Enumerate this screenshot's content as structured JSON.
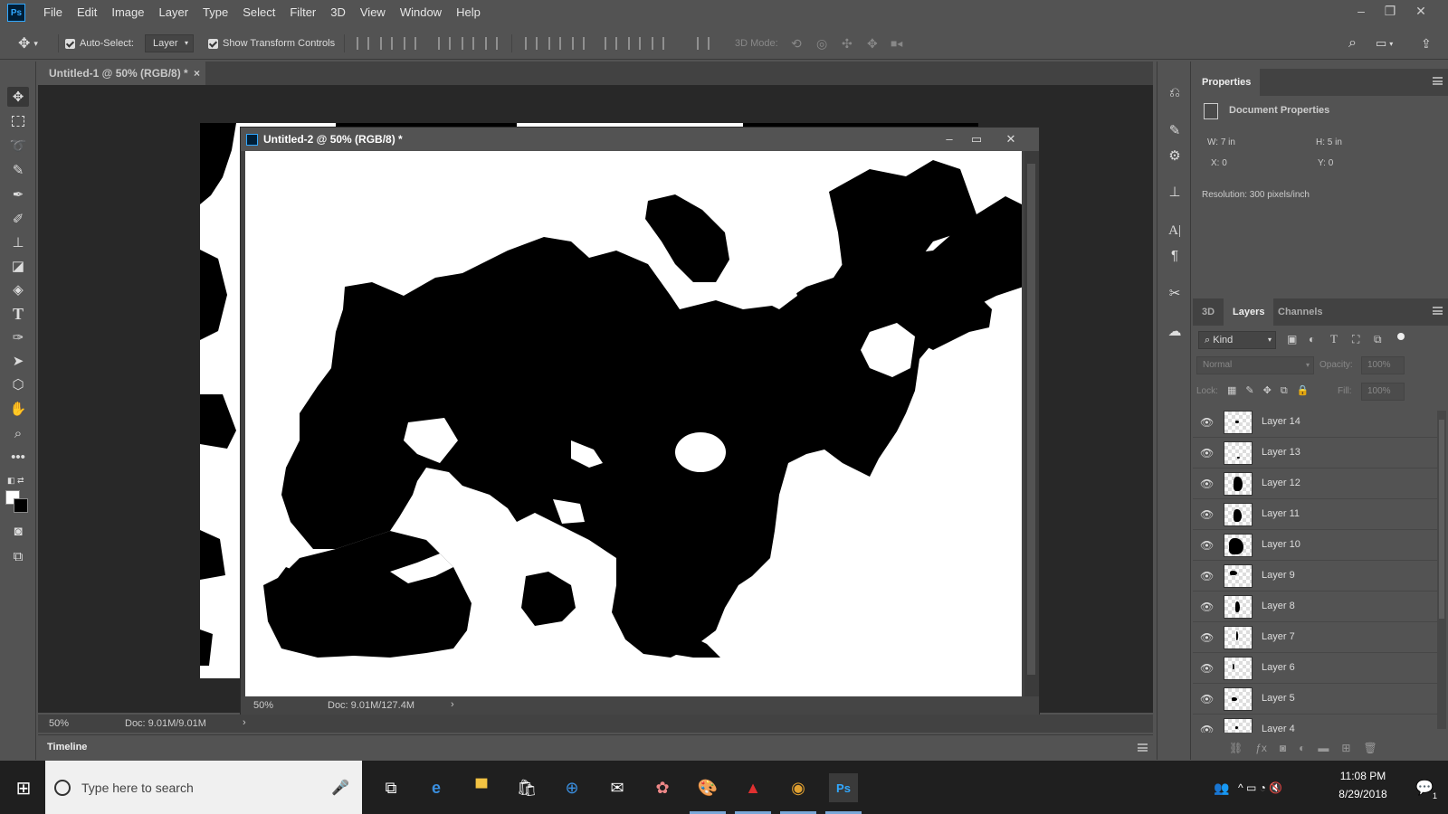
{
  "menubar": {
    "logo": "Ps",
    "items": [
      "File",
      "Edit",
      "Image",
      "Layer",
      "Type",
      "Select",
      "Filter",
      "3D",
      "View",
      "Window",
      "Help"
    ]
  },
  "options": {
    "auto_select_label": "Auto-Select:",
    "auto_select_value": "Layer",
    "transform_label": "Show Transform Controls",
    "mode_label": "3D Mode:"
  },
  "tabs": {
    "doc1_title": "Untitled-1 @ 50% (RGB/8) *",
    "doc1_close": "×"
  },
  "float_window": {
    "title": "Untitled-2 @ 50% (RGB/8) *",
    "zoom": "50%",
    "doc_size": "Doc: 9.01M/127.4M",
    "arrow": "›"
  },
  "status": {
    "zoom": "50%",
    "doc_size": "Doc: 9.01M/9.01M",
    "arrow": "›"
  },
  "timeline_label": "Timeline",
  "properties": {
    "tab": "Properties",
    "heading": "Document Properties",
    "w_label": "W:",
    "w_value": "7 in",
    "h_label": "H:",
    "h_value": "5 in",
    "x_label": "X:",
    "x_value": "0",
    "y_label": "Y:",
    "y_value": "0",
    "resolution": "Resolution: 300 pixels/inch"
  },
  "layers_panel": {
    "tabs": [
      "3D",
      "Layers",
      "Channels"
    ],
    "kind_filter": "Kind",
    "blend_mode": "Normal",
    "opacity_label": "Opacity:",
    "opacity_value": "100%",
    "lock_label": "Lock:",
    "fill_label": "Fill:",
    "fill_value": "100%",
    "layers": [
      "Layer 14",
      "Layer 13",
      "Layer 12",
      "Layer 11",
      "Layer 10",
      "Layer 9",
      "Layer 8",
      "Layer 7",
      "Layer 6",
      "Layer 5",
      "Layer 4"
    ]
  },
  "taskbar": {
    "search_placeholder": "Type here to search",
    "time": "11:08 PM",
    "date": "8/29/2018",
    "notification_count": "1"
  }
}
